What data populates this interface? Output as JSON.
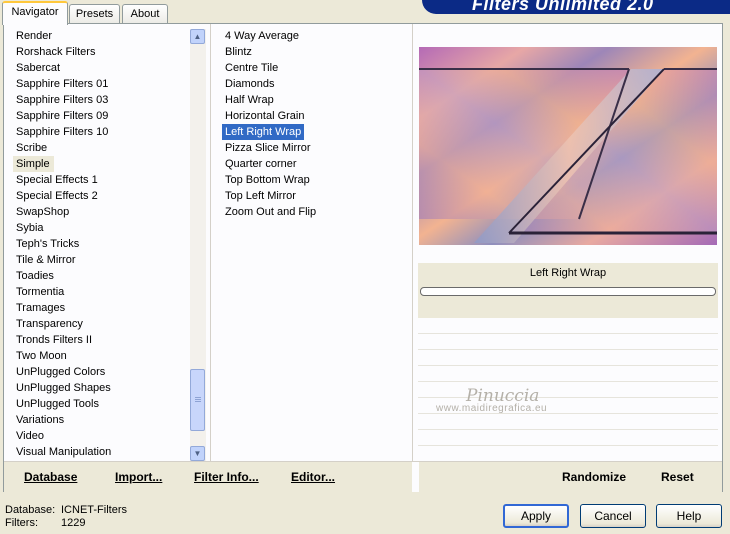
{
  "tabs": [
    {
      "label": "Navigator",
      "active": true
    },
    {
      "label": "Presets",
      "active": false
    },
    {
      "label": "About",
      "active": false
    }
  ],
  "banner": {
    "title": "Filters Unlimited 2.0"
  },
  "categories": {
    "items": [
      "Render",
      "Rorshack Filters",
      "Sabercat",
      "Sapphire Filters 01",
      "Sapphire Filters 03",
      "Sapphire Filters 09",
      "Sapphire Filters 10",
      "Scribe",
      "Simple",
      "Special Effects 1",
      "Special Effects 2",
      "SwapShop",
      "Sybia",
      "Teph's Tricks",
      "Tile & Mirror",
      "Toadies",
      "Tormentia",
      "Tramages",
      "Transparency",
      "Tronds Filters II",
      "Two Moon",
      "UnPlugged Colors",
      "UnPlugged Shapes",
      "UnPlugged Tools",
      "Variations",
      "Video",
      "Visual Manipulation"
    ],
    "selected": "Simple"
  },
  "filters": {
    "items": [
      "4 Way Average",
      "Blintz",
      "Centre Tile",
      "Diamonds",
      "Half Wrap",
      "Horizontal Grain",
      "Left Right Wrap",
      "Pizza Slice Mirror",
      "Quarter corner",
      "Top Bottom Wrap",
      "Top Left Mirror",
      "Zoom Out and Flip"
    ],
    "selected": "Left Right Wrap"
  },
  "preview": {
    "filter_name": "Left Right Wrap"
  },
  "watermark": {
    "name": "Pinuccia",
    "url": "www.maidiregrafica.eu"
  },
  "panel_buttons": {
    "database": "Database",
    "import": "Import...",
    "filter_info": "Filter Info...",
    "editor": "Editor...",
    "randomize": "Randomize",
    "reset": "Reset"
  },
  "info": {
    "database_label": "Database:",
    "database_value": "ICNET-Filters",
    "filters_label": "Filters:",
    "filters_value": "1229"
  },
  "dialog_buttons": {
    "apply": "Apply",
    "cancel": "Cancel",
    "help": "Help"
  },
  "colors": {
    "selection": "#316ac5",
    "banner": "#0b2a86",
    "tab_accent": "#ffc83c"
  }
}
